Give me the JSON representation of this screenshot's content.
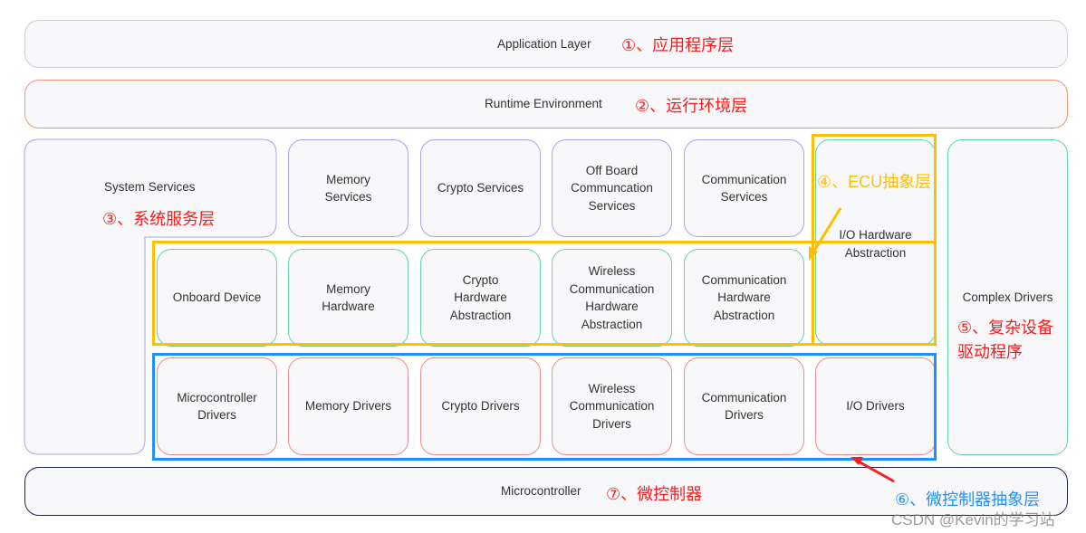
{
  "layers": {
    "application": "Application Layer",
    "runtime": "Runtime Environment",
    "system_services": "System Services",
    "memory_services": "Memory\nServices",
    "crypto_services": "Crypto Services",
    "offboard": "Off Board\nCommuncation\nServices",
    "comm_services": "Communication\nServices",
    "io_hw": "I/O Hardware\nAbstraction",
    "onboard": "Onboard Device",
    "memory_hw": "Memory\nHardware",
    "crypto_hw": "Crypto\nHardware\nAbstraction",
    "wireless_hw": "Wireless\nCommunication\nHardware\nAbstraction",
    "comm_hw": "Communication\nHardware\nAbstraction",
    "mcu_drivers": "Microcontroller\nDrivers",
    "memory_drivers": "Memory Drivers",
    "crypto_drivers": "Crypto Drivers",
    "wireless_drivers": "Wireless\nCommunication\nDrivers",
    "comm_drivers": "Communication\nDrivers",
    "io_drivers": "I/O Drivers",
    "complex": "Complex Drivers",
    "microcontroller": "Microcontroller"
  },
  "annotations": {
    "a1": "①、应用程序层",
    "a2": "②、运行环境层",
    "a3": "③、系统服务层",
    "a4": "④、ECU抽象层",
    "a5": "⑤、复杂设备\n驱动程序",
    "a6": "⑥、微控制器抽象层",
    "a7": "⑦、微控制器"
  },
  "watermark": "CSDN @Kevin的学习站",
  "colors": {
    "red": "#ff1a1a",
    "yellow": "#ffbf00",
    "blue": "#1e90ff"
  }
}
